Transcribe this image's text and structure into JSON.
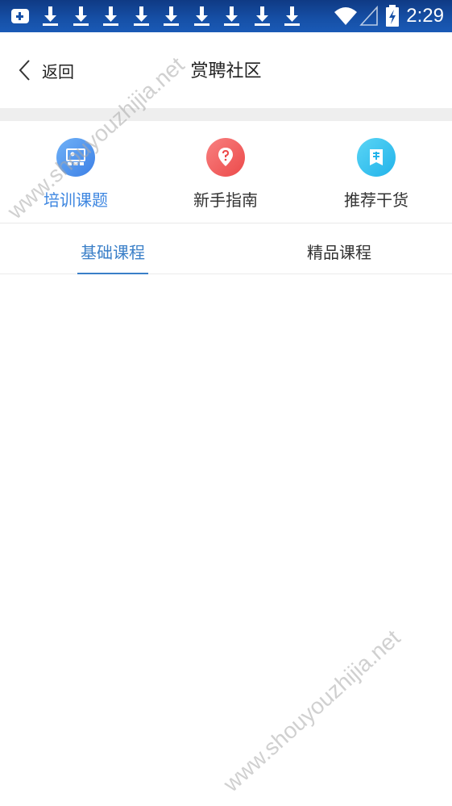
{
  "status_bar": {
    "time": "2:29",
    "icons": [
      "notification-icon",
      "download-icon",
      "download-icon",
      "download-icon",
      "download-icon",
      "download-icon",
      "download-icon",
      "download-icon",
      "download-icon",
      "download-icon",
      "wifi-icon",
      "signal-icon",
      "battery-charging-icon"
    ],
    "background": "#1650a7"
  },
  "header": {
    "back_label": "返回",
    "title": "赏聘社区"
  },
  "categories": [
    {
      "label": "培训课题",
      "icon": "training-icon",
      "color": "#4f95f0",
      "active": true
    },
    {
      "label": "新手指南",
      "icon": "question-icon",
      "color": "#f25c5c",
      "active": false
    },
    {
      "label": "推荐干货",
      "icon": "recommend-icon",
      "color": "#2fbfef",
      "active": false
    }
  ],
  "tabs": [
    {
      "label": "基础课程",
      "active": true
    },
    {
      "label": "精品课程",
      "active": false
    }
  ],
  "colors": {
    "accent": "#3a7fc8",
    "divider": "#eeeeee"
  },
  "watermark": "www.shouyouzhijia.net"
}
